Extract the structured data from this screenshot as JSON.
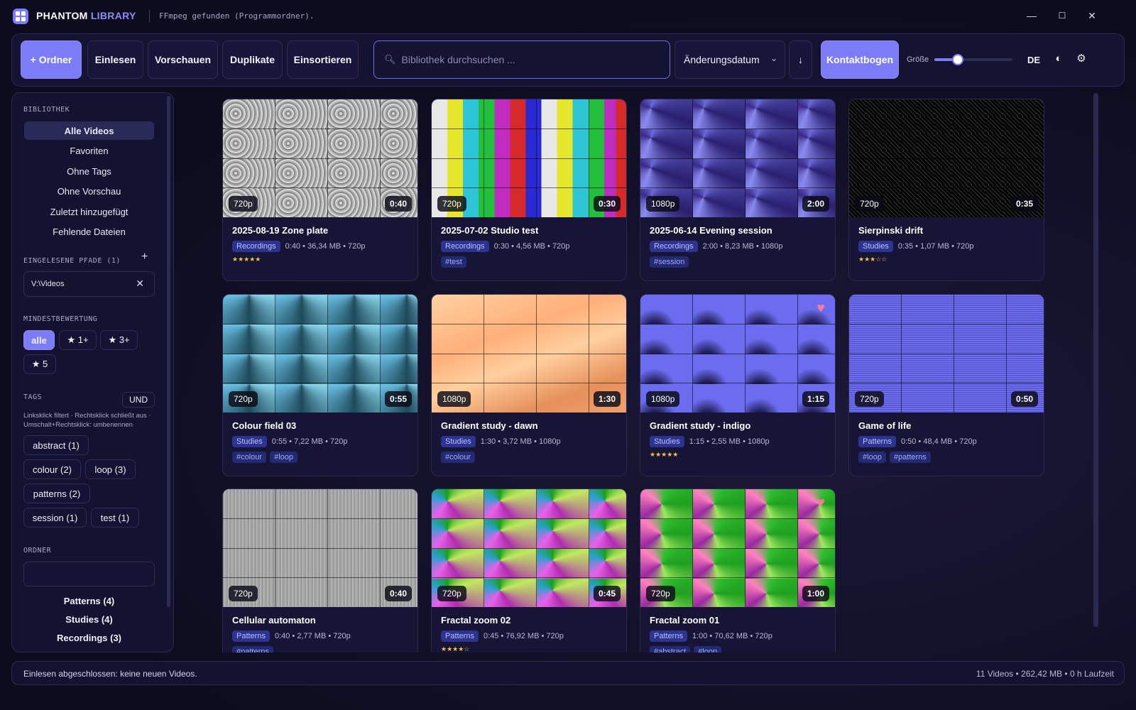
{
  "titlebar": {
    "brand_part1": "PHANTOM",
    "brand_part2": "LIBRARY",
    "ffmpeg_status": "FFmpeg gefunden (Programmordner).",
    "minimize_glyph": "—",
    "maximize_glyph": "☐",
    "close_glyph": "✕"
  },
  "toolbar": {
    "folder_label": "+ Ordner",
    "scan_label": "Einlesen",
    "previews_label": "Vorschauen",
    "duplicates_label": "Duplikate",
    "sort_in_label": "Einsortieren",
    "search_placeholder": "Bibliothek durchsuchen ...",
    "sort_field": "Änderungsdatum",
    "sort_direction_glyph": "↓",
    "contact_sheet_label": "Kontaktbogen",
    "size_label": "Größe",
    "size_value": 0.3,
    "language": "DE",
    "theme_icon": "contrast-icon",
    "settings_icon": "gear-icon"
  },
  "sidebar": {
    "library_heading": "BIBLIOTHEK",
    "nav_items": [
      {
        "label": "Alle Videos",
        "active": true
      },
      {
        "label": "Favoriten",
        "active": false
      },
      {
        "label": "Ohne Tags",
        "active": false
      },
      {
        "label": "Ohne Vorschau",
        "active": false
      },
      {
        "label": "Zuletzt hinzugefügt",
        "active": false
      },
      {
        "label": "Fehlende Dateien",
        "active": false
      }
    ],
    "paths_heading": "EINGELESENE PFADE (1)",
    "add_path_glyph": "+",
    "paths": [
      {
        "path": "V:\\Videos"
      }
    ],
    "rating_heading": "MINDESTBEWERTUNG",
    "rating_options": [
      "alle",
      "★ 1+",
      "★ 3+",
      "★ 5"
    ],
    "rating_selected": "alle",
    "tags_heading": "TAGS",
    "tags_mode": "UND",
    "tags_hint": "Linksklick filtert · Rechtsklick schließt aus · Umschalt+Rechtsklick: umbenennen",
    "tags": [
      "abstract (1)",
      "colour (2)",
      "loop (3)",
      "patterns (2)",
      "session (1)",
      "test (1)"
    ],
    "folders_heading": "ORDNER",
    "folders": [
      "Patterns (4)",
      "Studies (4)",
      "Recordings (3)"
    ]
  },
  "videos": [
    {
      "title": "2025-08-19 Zone plate",
      "resolution": "720p",
      "duration": "0:40",
      "category": "Recordings",
      "meta": "0:40 • 36,34 MB • 720p",
      "stars": "★★★★★",
      "tags": [],
      "favorite": false
    },
    {
      "title": "2025-07-02 Studio test",
      "resolution": "720p",
      "duration": "0:30",
      "category": "Recordings",
      "meta": "0:30 • 4,56 MB • 720p",
      "stars": "",
      "tags": [
        "#test"
      ],
      "favorite": false
    },
    {
      "title": "2025-06-14 Evening session",
      "resolution": "1080p",
      "duration": "2:00",
      "category": "Recordings",
      "meta": "2:00 • 8,23 MB • 1080p",
      "stars": "",
      "tags": [
        "#session"
      ],
      "favorite": false
    },
    {
      "title": "Sierpinski drift",
      "resolution": "720p",
      "duration": "0:35",
      "category": "Studies",
      "meta": "0:35 • 1,07 MB • 720p",
      "stars": "★★★☆☆",
      "tags": [],
      "favorite": false
    },
    {
      "title": "Colour field 03",
      "resolution": "720p",
      "duration": "0:55",
      "category": "Studies",
      "meta": "0:55 • 7,22 MB • 720p",
      "stars": "",
      "tags": [
        "#colour",
        "#loop"
      ],
      "favorite": false
    },
    {
      "title": "Gradient study - dawn",
      "resolution": "1080p",
      "duration": "1:30",
      "category": "Studies",
      "meta": "1:30 • 3,72 MB • 1080p",
      "stars": "",
      "tags": [
        "#colour"
      ],
      "favorite": false
    },
    {
      "title": "Gradient study - indigo",
      "resolution": "1080p",
      "duration": "1:15",
      "category": "Studies",
      "meta": "1:15 • 2,55 MB • 1080p",
      "stars": "★★★★★",
      "tags": [],
      "favorite": true
    },
    {
      "title": "Game of life",
      "resolution": "720p",
      "duration": "0:50",
      "category": "Patterns",
      "meta": "0:50 • 48,4 MB • 720p",
      "stars": "",
      "tags": [
        "#loop",
        "#patterns"
      ],
      "favorite": false
    },
    {
      "title": "Cellular automaton",
      "resolution": "720p",
      "duration": "0:40",
      "category": "Patterns",
      "meta": "0:40 • 2,77 MB • 720p",
      "stars": "",
      "tags": [
        "#patterns"
      ],
      "favorite": false
    },
    {
      "title": "Fractal zoom 02",
      "resolution": "720p",
      "duration": "0:45",
      "category": "Patterns",
      "meta": "0:45 • 76,92 MB • 720p",
      "stars": "★★★★☆",
      "tags": [],
      "favorite": false
    },
    {
      "title": "Fractal zoom 01",
      "resolution": "720p",
      "duration": "1:00",
      "category": "Patterns",
      "meta": "1:00 • 70,62 MB • 720p",
      "stars": "",
      "tags": [
        "#abstract",
        "#loop"
      ],
      "favorite": true
    }
  ],
  "statusbar": {
    "message": "Einlesen abgeschlossen: keine neuen Videos.",
    "summary": "11 Videos • 262,42 MB • 0 h Laufzeit"
  },
  "colors": {
    "accent": "#7c7cf6",
    "background": "#0d0c1e",
    "star": "#f3c244",
    "heart": "#f27c9a"
  }
}
